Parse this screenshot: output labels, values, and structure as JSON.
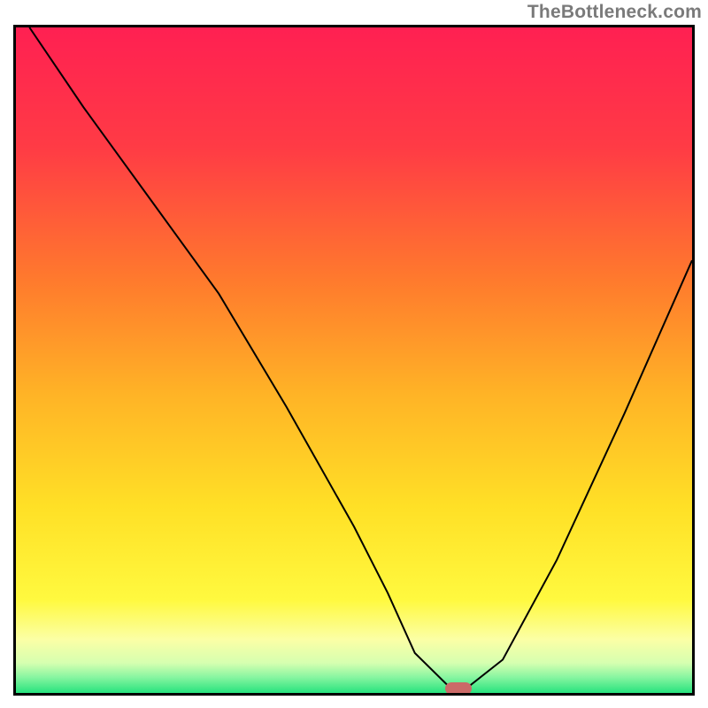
{
  "attribution": "TheBottleneck.com",
  "chart_data": {
    "type": "line",
    "title": "",
    "xlabel": "",
    "ylabel": "",
    "x_range": [
      0,
      100
    ],
    "y_range": [
      0,
      100
    ],
    "curve": {
      "name": "bottleneck-curve",
      "x": [
        2,
        10,
        20,
        30,
        40,
        50,
        55,
        59,
        64,
        67,
        72,
        80,
        90,
        100
      ],
      "y": [
        100,
        88,
        74,
        60,
        43,
        25,
        15,
        6,
        1,
        1,
        5,
        20,
        42,
        65
      ]
    },
    "optimum_marker": {
      "x": 65.5,
      "y": 0.7
    },
    "gradient_stops": [
      {
        "pos": 0.0,
        "color": "#ff2052"
      },
      {
        "pos": 0.18,
        "color": "#ff3b45"
      },
      {
        "pos": 0.38,
        "color": "#ff7a2d"
      },
      {
        "pos": 0.55,
        "color": "#ffb326"
      },
      {
        "pos": 0.72,
        "color": "#ffe026"
      },
      {
        "pos": 0.86,
        "color": "#fff93f"
      },
      {
        "pos": 0.92,
        "color": "#fbffa6"
      },
      {
        "pos": 0.955,
        "color": "#d6ffb0"
      },
      {
        "pos": 0.975,
        "color": "#8df6a2"
      },
      {
        "pos": 1.0,
        "color": "#27e37e"
      }
    ]
  }
}
